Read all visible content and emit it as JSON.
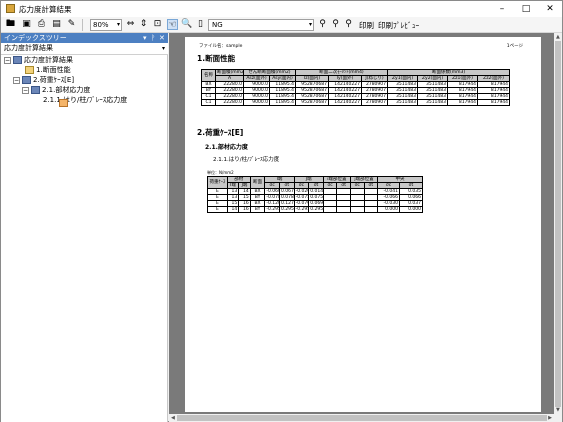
{
  "window": {
    "title": "応力度計算結果"
  },
  "toolbar": {
    "zoom_value": "80%",
    "search_value": "NG",
    "print_label": "印刷",
    "print_preview_label": "印刷ﾌﾟﾚﾋﾞｭｰ"
  },
  "index_pane": {
    "title": "インデックスツリー",
    "pin_glyph": "ᚹ",
    "close_glyph": "✕",
    "menu_glyph": "▾",
    "selected_value": "応力度計算結果",
    "tree": [
      {
        "label": "応力度計算結果",
        "level": 0
      },
      {
        "label": "1.断面性能",
        "level": 1
      },
      {
        "label": "2.荷重ｹｰｽ[E]",
        "level": 1
      },
      {
        "label": "2.1.部材応力度",
        "level": 2
      },
      {
        "label": "2.1.1.はり/柱/ﾌﾞﾚｰｽ応力度",
        "level": 3
      }
    ]
  },
  "report": {
    "file_label": "ファイル名：",
    "file_name": "sample",
    "page_label": "1ページ",
    "section1_title": "1.断面性能",
    "table1": {
      "header_row1": [
        "",
        "断面積(mm2)",
        "せん断断面積(mm2)",
        "",
        "断面二次ﾓｰﾒﾝﾄ(mm4)",
        "",
        "",
        "断面係数(mm3)",
        "",
        "",
        ""
      ],
      "header_row2": [
        "名称",
        "A",
        "Asz(面外)",
        "Asy(面内)",
        "Iz(面内)",
        "Iy(面外)",
        "J(ねじり)",
        "Zy1(面内)",
        "Zy2(面内)",
        "Zz1(面外)",
        "Zz2(面外)"
      ],
      "rows": [
        [
          "BX",
          "22280.0",
          "9000.0",
          "11895.4",
          "952870687",
          "142140227",
          "2780907",
          "3511483",
          "3511483",
          "817944",
          "817944"
        ],
        [
          "BY",
          "22280.0",
          "9000.0",
          "11895.4",
          "952870687",
          "142140227",
          "2780907",
          "3511483",
          "3511483",
          "817944",
          "817944"
        ],
        [
          "C1",
          "22280.0",
          "9000.0",
          "11895.4",
          "952870687",
          "142140227",
          "2780907",
          "3511483",
          "3511483",
          "817944",
          "817944"
        ],
        [
          "C1",
          "22280.0",
          "9000.0",
          "11895.4",
          "952870687",
          "142140227",
          "2780907",
          "3511483",
          "3511483",
          "817944",
          "817944"
        ]
      ]
    },
    "section2_title": "2.荷重ｹｰｽ[E]",
    "section21_title": "2.1.部材応力度",
    "section211_title": "2.1.1.はり/柱/ﾌﾞﾚｰｽ応力度",
    "unit_label": "単位：N/mm2",
    "table2": {
      "header_row1": [
        "荷重ｹｰｽ",
        "部材",
        "",
        "断面",
        "I端",
        "",
        "J端",
        "",
        "i端部位置",
        "",
        "j端部位置",
        "",
        "中央",
        ""
      ],
      "header_row2": [
        "",
        "I端",
        "J端",
        "",
        "σc",
        "σt",
        "σc",
        "σt",
        "σc",
        "σt",
        "σc",
        "σt",
        "σc",
        "σt"
      ],
      "rows": [
        [
          "E",
          "13",
          "14",
          "BX",
          "-0.060",
          "0.067",
          "-0.020",
          "0.014",
          "",
          "",
          "",
          "",
          "-0.041",
          "0.035"
        ],
        [
          "E",
          "13",
          "15",
          "BY",
          "-0.078",
          "0.078",
          "-0.075",
          "0.075",
          "",
          "",
          "",
          "",
          "-0.066",
          "0.066"
        ],
        [
          "E",
          "15",
          "16",
          "BX",
          "-0.120",
          "0.127",
          "-0.070",
          "0.069",
          "",
          "",
          "",
          "",
          "-0.030",
          "0.037"
        ],
        [
          "E",
          "14",
          "16",
          "BY",
          "-0.295",
          "0.295",
          "-0.295",
          "0.295",
          "",
          "",
          "",
          "",
          "0.000",
          "0.000"
        ]
      ]
    }
  }
}
